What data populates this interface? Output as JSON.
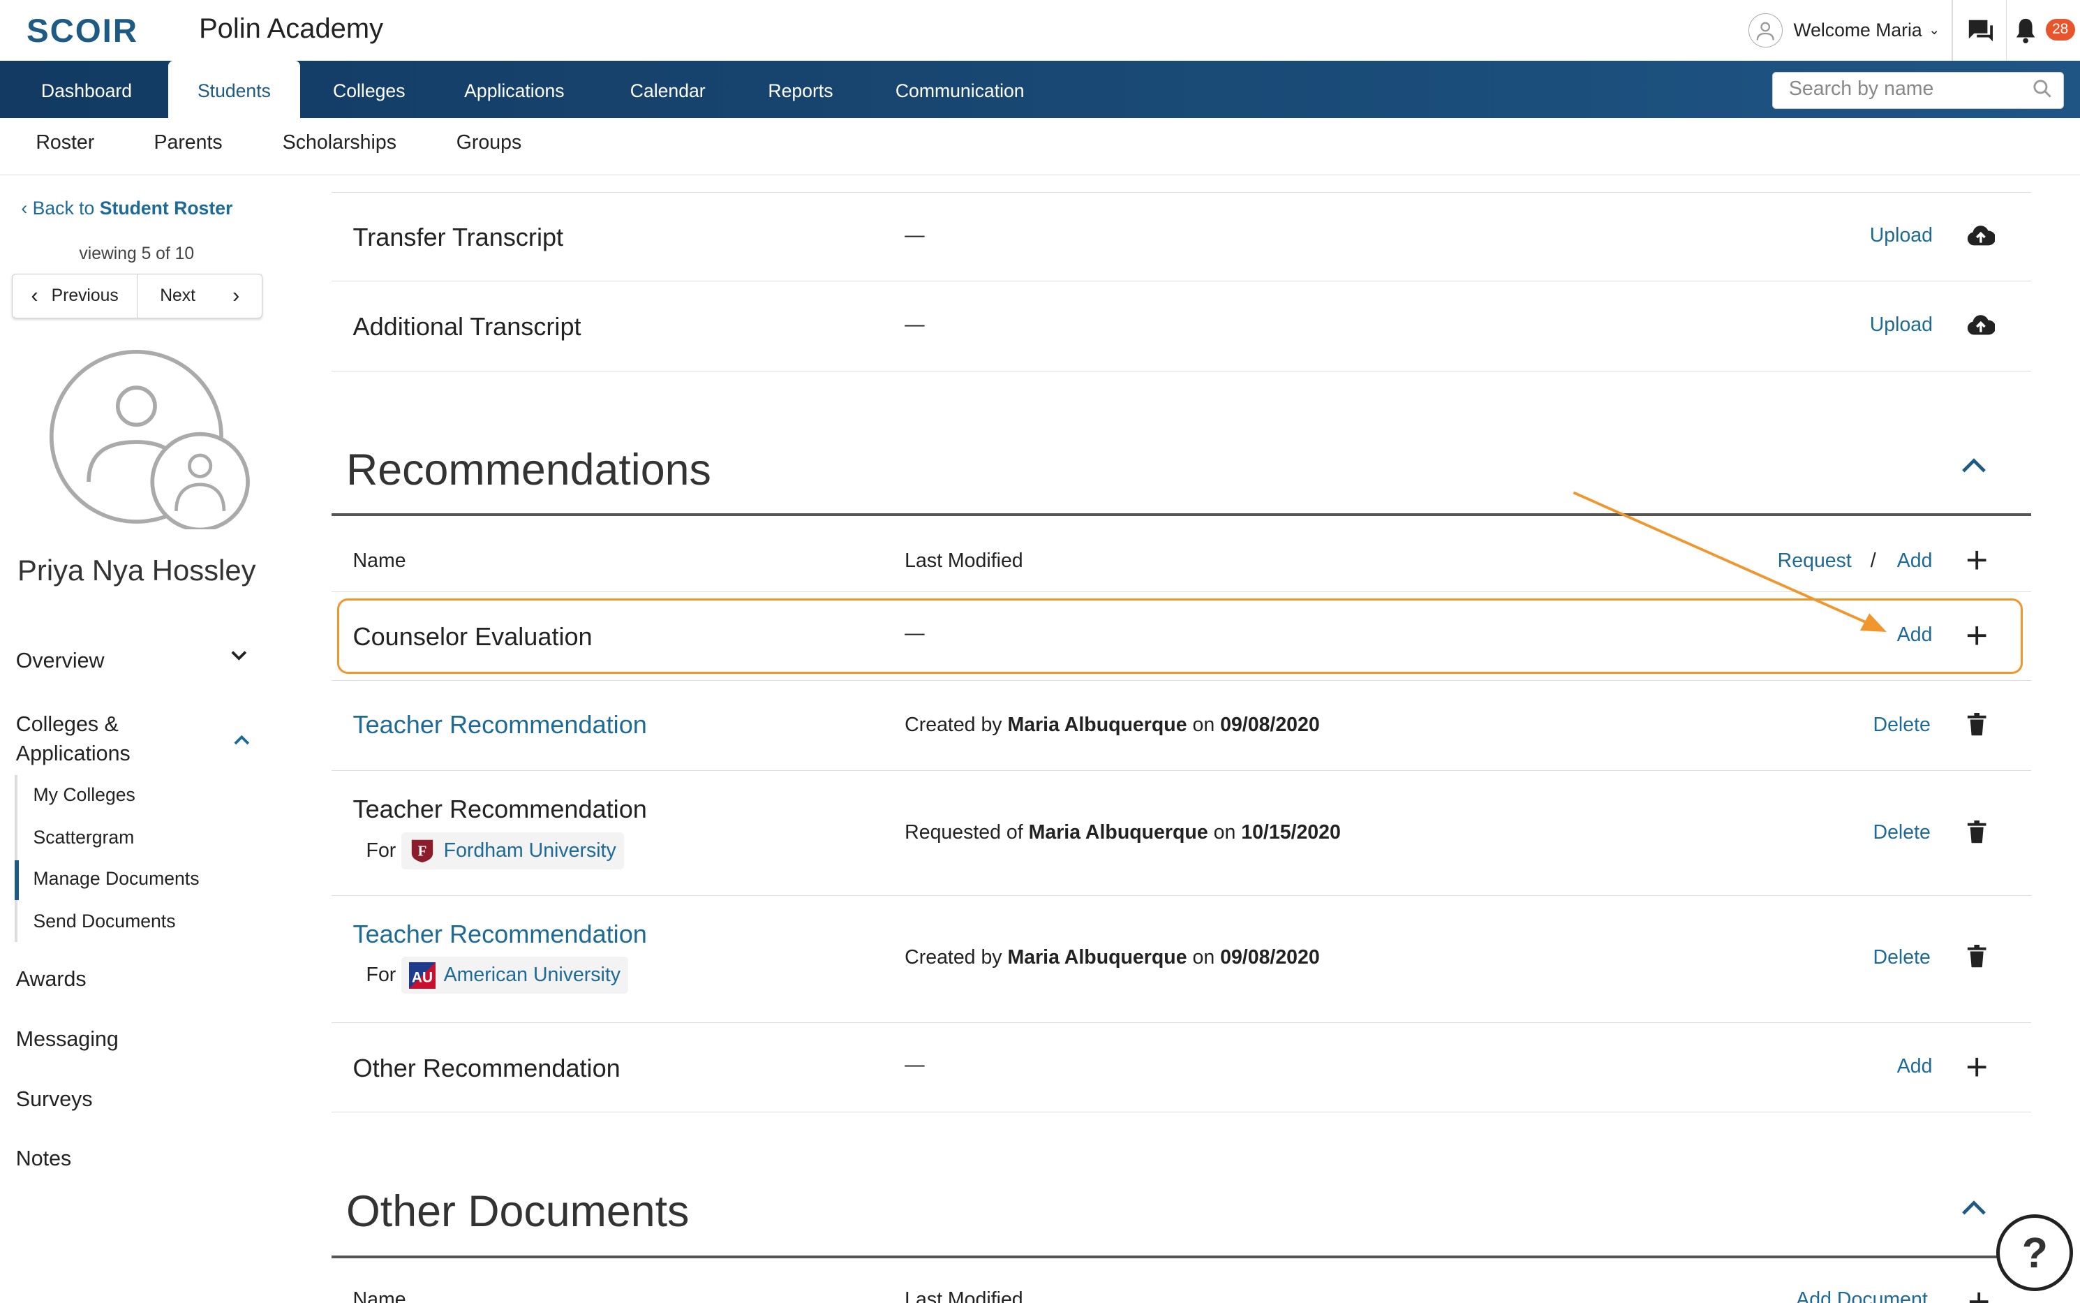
{
  "header": {
    "logo": "SCOIR",
    "school": "Polin Academy",
    "welcome": "Welcome Maria",
    "notification_count": "28"
  },
  "nav": {
    "tabs": [
      "Dashboard",
      "Students",
      "Colleges",
      "Applications",
      "Calendar",
      "Reports",
      "Communication"
    ],
    "active_tab": "Students",
    "search_placeholder": "Search by name"
  },
  "subnav": {
    "items": [
      "Roster",
      "Parents",
      "Scholarships",
      "Groups"
    ]
  },
  "sidebar": {
    "back_prefix": "Back to",
    "back_target": "Student Roster",
    "viewing": "viewing 5 of 10",
    "prev_label": "Previous",
    "next_label": "Next",
    "student_name": "Priya Nya Hossley",
    "items": {
      "overview": "Overview",
      "colleges_apps": "Colleges &",
      "colleges_apps2": "Applications",
      "my_colleges": "My Colleges",
      "scattergram": "Scattergram",
      "manage_documents": "Manage Documents",
      "send_documents": "Send Documents",
      "awards": "Awards",
      "messaging": "Messaging",
      "surveys": "Surveys",
      "notes": "Notes"
    }
  },
  "transcripts": [
    {
      "name": "Transfer Transcript",
      "modified": "—",
      "action": "Upload"
    },
    {
      "name": "Additional Transcript",
      "modified": "—",
      "action": "Upload"
    }
  ],
  "recommendations": {
    "title": "Recommendations",
    "col_name": "Name",
    "col_modified": "Last Modified",
    "request_label": "Request",
    "slash": "/",
    "add_label": "Add",
    "rows": [
      {
        "name": "Counselor Evaluation",
        "modified": "—",
        "action": "Add"
      },
      {
        "name": "Teacher Recommendation",
        "prefix": "Created by",
        "person": "Maria Albuquerque",
        "on": "on",
        "date": "09/08/2020",
        "action": "Delete"
      },
      {
        "name": "Teacher Recommendation",
        "for": "For",
        "college": "Fordham University",
        "prefix": "Requested of",
        "person": "Maria Albuquerque",
        "on": "on",
        "date": "10/15/2020",
        "action": "Delete"
      },
      {
        "name": "Teacher Recommendation",
        "for": "For",
        "college": "American University",
        "prefix": "Created by",
        "person": "Maria Albuquerque",
        "on": "on",
        "date": "09/08/2020",
        "action": "Delete"
      },
      {
        "name": "Other Recommendation",
        "modified": "—",
        "action": "Add"
      }
    ]
  },
  "other_documents": {
    "title": "Other Documents",
    "col_name": "Name",
    "col_modified": "Last Modified",
    "add_label": "Add Document"
  },
  "colors": {
    "nav_dark": "#123a62",
    "link": "#1e6a96",
    "highlight": "#f0962d",
    "badge": "#e8542b"
  }
}
